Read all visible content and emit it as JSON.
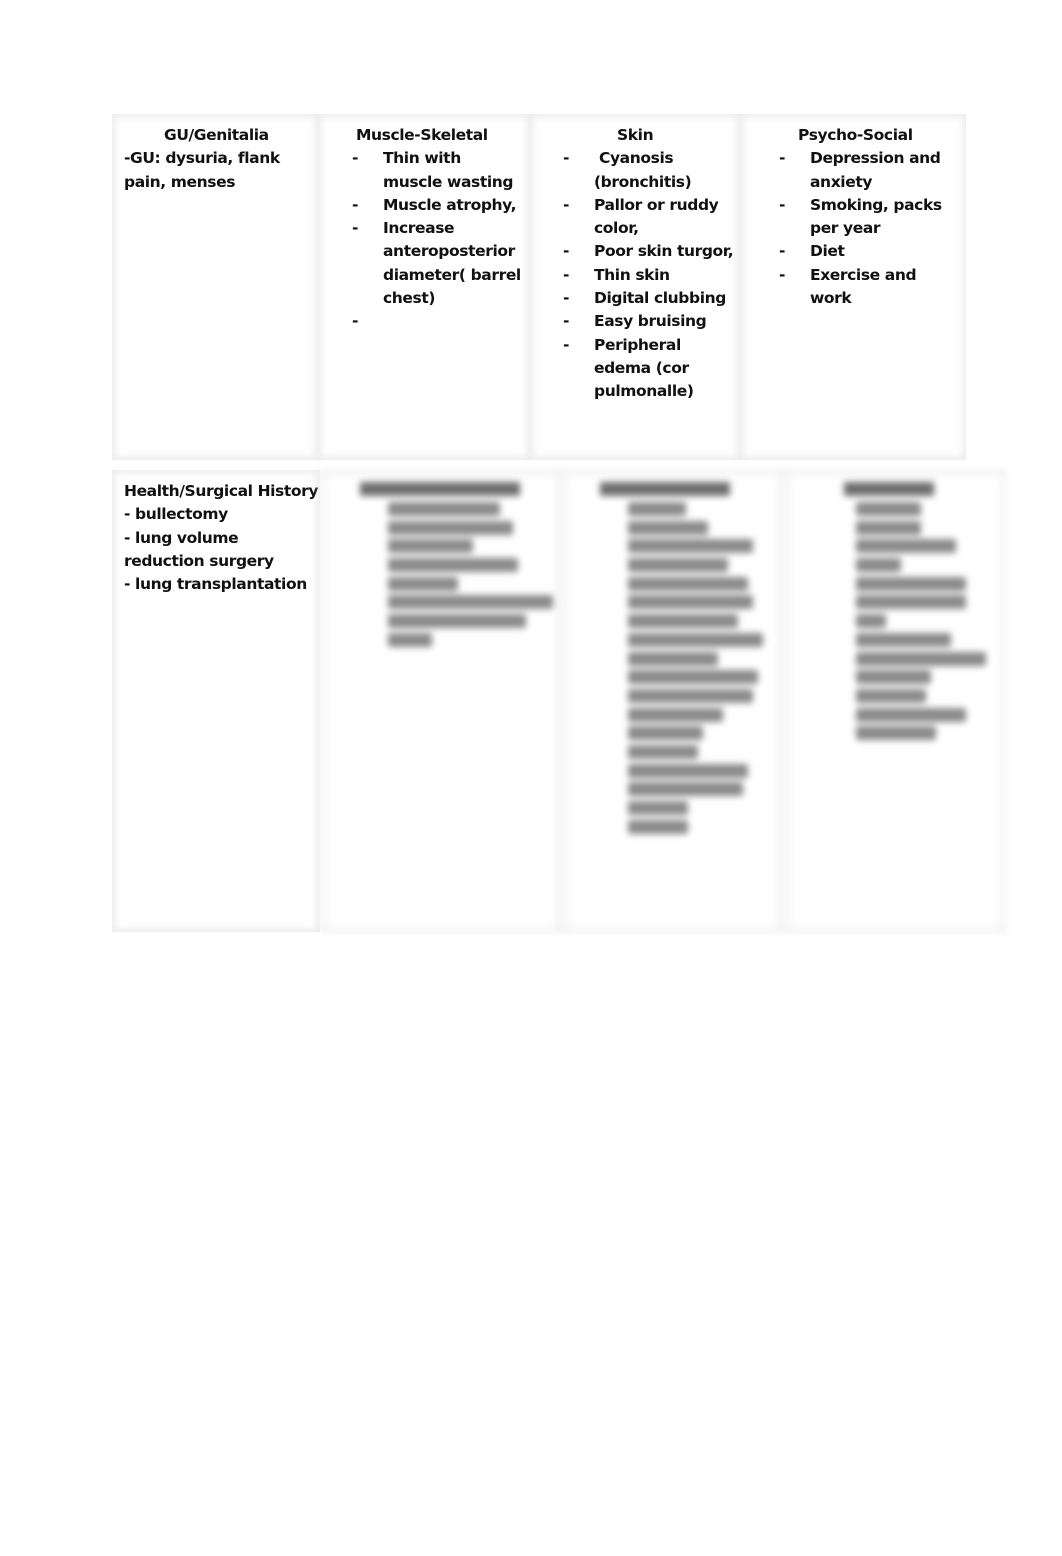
{
  "row1": {
    "gu": {
      "heading": "GU/Genitalia",
      "lines": [
        "-GU: dysuria, flank",
        "pain, menses"
      ]
    },
    "musculoskeletal": {
      "heading": "Muscle-Skeletal",
      "bullet": "-",
      "items": [
        "Thin with muscle wasting",
        "Muscle atrophy,",
        "Increase anteroposterior diameter( barrel chest)",
        ""
      ]
    },
    "skin": {
      "heading": "Skin",
      "bullet": "-",
      "items": [
        " Cyanosis (bronchitis)",
        "Pallor or ruddy color,",
        "Poor skin turgor,",
        "Thin skin",
        "Digital clubbing",
        "Easy bruising",
        "Peripheral edema (cor pulmonalle)"
      ]
    },
    "psychosocial": {
      "heading": "Psycho-Social",
      "bullet": "-",
      "items": [
        "Depression and anxiety",
        "Smoking, packs per year",
        "Diet",
        "Exercise and work"
      ]
    }
  },
  "row2": {
    "history": {
      "heading": "Health/Surgical History",
      "lines": [
        "- bullectomy",
        "- lung volume",
        "reduction surgery",
        "- lung transplantation"
      ]
    },
    "blurred_columns": [
      {
        "heading": "[blurred heading]",
        "note": "content obscured (blurred)"
      },
      {
        "heading": "[blurred heading]",
        "note": "content obscured (blurred)"
      },
      {
        "heading": "[blurred heading]",
        "note": "content obscured (blurred)"
      }
    ]
  }
}
